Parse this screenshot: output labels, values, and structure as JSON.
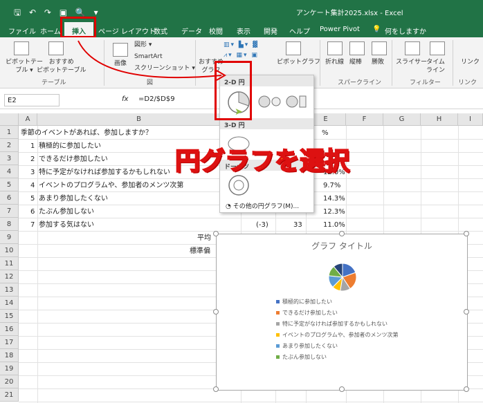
{
  "titlebar": {
    "qat": "🖫 ↶ ↷ ▣ 🔍 ▾",
    "filename": "アンケート集計2025.xlsx  -  Excel"
  },
  "tabs": [
    "ファイル",
    "ホーム",
    "挿入",
    "ページ レイアウト",
    "数式",
    "データ",
    "校閲",
    "表示",
    "開発",
    "ヘルプ",
    "Power Pivot",
    "何をしますか"
  ],
  "ribbon": {
    "pivot": "ピボットテー\nブル ▾",
    "rec_pivot": "おすすめ\nピボットテーブル",
    "table_group": "テーブル",
    "image": "画像",
    "shape": "図形 ▾",
    "smartart": "SmartArt",
    "screenshot": "スクリーンショット ▾",
    "illust_group": "図",
    "rec_chart": "おすすめ\nグラフ",
    "pivot_chart": "ピボットグラフ",
    "line": "折れ線",
    "column": "縦棒",
    "winloss": "勝敗",
    "spark_group": "スパークライン",
    "slicer": "スライサー",
    "timeline": "タイム\nライン",
    "filter_group": "フィルター",
    "link": "リンク",
    "link_group": "リンク"
  },
  "formula": {
    "namebox": "E2",
    "fx": "fx",
    "value": "=D2/$D$9"
  },
  "columns": [
    "A",
    "B",
    "C",
    "D",
    "E",
    "F",
    "G",
    "H",
    "I"
  ],
  "rows": [
    "1",
    "2",
    "3",
    "4",
    "5",
    "6",
    "7",
    "8",
    "9",
    "10",
    "11",
    "12",
    "13",
    "14",
    "15",
    "16",
    "17",
    "18",
    "19",
    "20",
    "21"
  ],
  "cells": {
    "a1": "季節のイベントがあれば、参加しますか？",
    "e1": "%",
    "items": [
      {
        "n": "1",
        "t": "積極的に参加したい",
        "e": ""
      },
      {
        "n": "2",
        "t": "できるだけ参加したい",
        "e": ""
      },
      {
        "n": "3",
        "t": "特に予定がなければ参加するかもしれない",
        "e": "12.0%"
      },
      {
        "n": "4",
        "t": "イベントのプログラムや、参加者のメンツ次第",
        "e": "9.7%"
      },
      {
        "n": "5",
        "t": "あまり参加したくない",
        "e": "14.3%"
      },
      {
        "n": "6",
        "t": "たぶん参加しない",
        "e": "12.3%"
      },
      {
        "n": "7",
        "t": "参加する気はない",
        "e": "11.0%"
      }
    ],
    "c8": "(-3)",
    "d8": "33",
    "b9": "平均",
    "b10": "標準偏"
  },
  "dropdown": {
    "h2d": "2-D 円",
    "h3d": "3-D 円",
    "hdonut": "ドーナツ",
    "more": "その他の円グラフ(M)..."
  },
  "chart": {
    "title": "グラフ タイトル",
    "legend": [
      "積極的に参加したい",
      "できるだけ参加したい",
      "特に予定がなければ参加するかもしれない",
      "イベントのプログラムや、参加者のメンツ次第",
      "あまり参加したくない",
      "たぶん参加しない"
    ],
    "colors": [
      "#4472c4",
      "#ed7d31",
      "#a5a5a5",
      "#ffc000",
      "#5b9bd5",
      "#70ad47",
      "#264478"
    ]
  },
  "chart_data": {
    "type": "pie",
    "title": "グラフ タイトル",
    "categories": [
      "積極的に参加したい",
      "できるだけ参加したい",
      "特に予定がなければ参加するかもしれない",
      "イベントのプログラムや、参加者のメンツ次第",
      "あまり参加したくない",
      "たぶん参加しない",
      "参加する気はない"
    ],
    "values": [
      19.5,
      21.2,
      12.0,
      9.7,
      14.3,
      12.3,
      11.0
    ]
  },
  "banner": "円グラフを選択",
  "accent": "#217346",
  "highlight": "#e00000"
}
